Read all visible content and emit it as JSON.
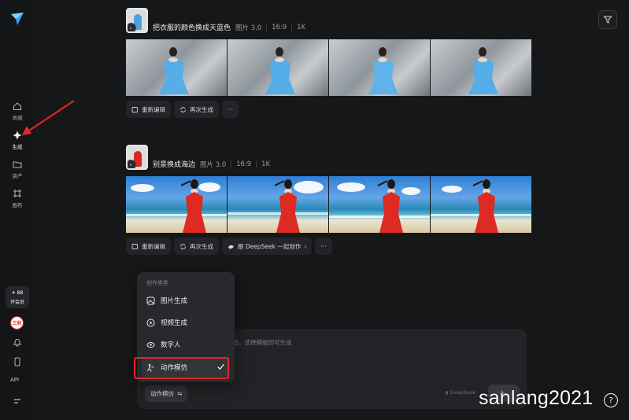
{
  "sidebar": {
    "items": [
      {
        "label": "灵感",
        "icon": "home-icon"
      },
      {
        "label": "生成",
        "icon": "sparkle-icon"
      },
      {
        "label": "资产",
        "icon": "folder-icon"
      },
      {
        "label": "画布",
        "icon": "canvas-icon"
      }
    ],
    "vip_count": "88",
    "vip_label": "开会员",
    "avatar_text": "三利",
    "api_label": "API"
  },
  "tasks": [
    {
      "prompt": "把衣服的颜色换成天蓝色",
      "model": "图片 3.0",
      "ratio": "16:9",
      "resolution": "1K",
      "actions": [
        "重新编辑",
        "再次生成"
      ]
    },
    {
      "prompt": "别景换成海边",
      "model": "图片 3.0",
      "ratio": "16:9",
      "resolution": "1K",
      "actions": [
        "重新编辑",
        "再次生成",
        "跟 DeepSeek 一起创作"
      ]
    }
  ],
  "dropdown": {
    "title": "创作类型",
    "options": [
      {
        "label": "图片生成",
        "icon": "image-gen-icon"
      },
      {
        "label": "视频生成",
        "icon": "video-gen-icon"
      },
      {
        "label": "数字人",
        "icon": "digital-human-icon"
      },
      {
        "label": "动作模仿",
        "icon": "motion-mimic-icon",
        "selected": true
      }
    ]
  },
  "composer": {
    "hint": "片后，选择模版即可生成",
    "mode_chip": "动作模仿",
    "deepseek_mark": "DeepSeek"
  },
  "watermark": "sanlang2021",
  "colors": {
    "background": "#161718",
    "highlight": "#e0282c",
    "annotation_arrow": "#e0282c"
  }
}
